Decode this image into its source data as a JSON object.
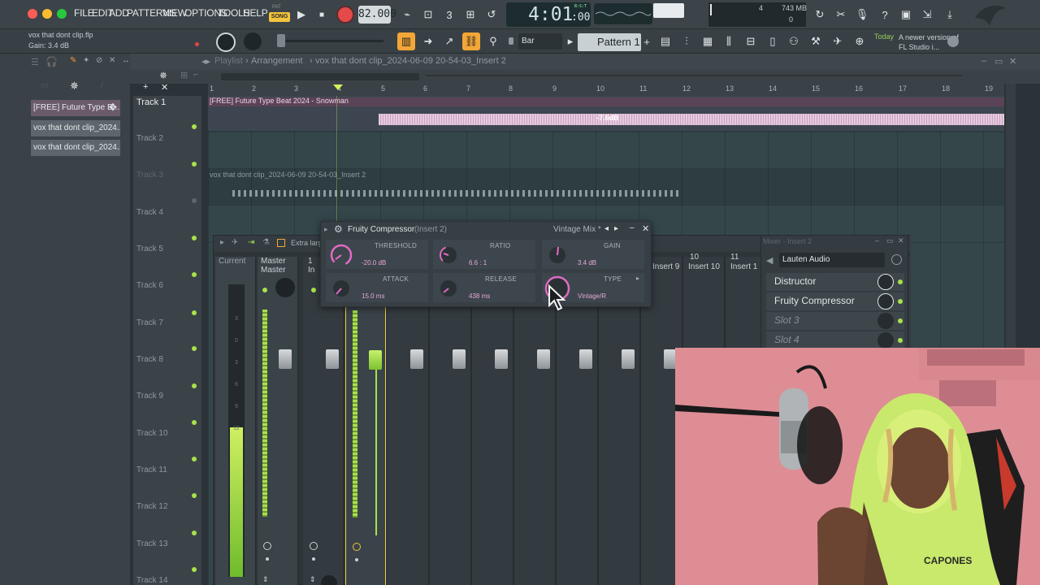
{
  "menu": [
    "FILE",
    "EDIT",
    "ADD",
    "PATTERNS",
    "VIEW",
    "OPTIONS",
    "TOOLS",
    "HELP"
  ],
  "transport": {
    "mode_label": "SONG",
    "mode_sub": "PAT",
    "tempo": "82.000",
    "time": "4:01",
    "time_small": ":00",
    "time_label": "B:S:T"
  },
  "stats": {
    "memory": "743 MB",
    "cpu_count": "4",
    "voices": "0"
  },
  "hint": {
    "file": "vox that dont clip.flp",
    "gain": "Gain: 3.4 dB"
  },
  "pattern": {
    "snap": "Bar",
    "name": "Pattern 1"
  },
  "news": {
    "label": "Today",
    "text": "A newer version of FL Studio i..."
  },
  "playlist": {
    "title": "Playlist",
    "sep": "›",
    "breadcrumb": "Arrangement",
    "file": "vox that dont clip_2024-06-09 20-54-03_Insert 2",
    "ruler": [
      "1",
      "2",
      "3",
      "4",
      "5",
      "6",
      "7",
      "8",
      "9",
      "10",
      "11",
      "12",
      "13",
      "14",
      "15",
      "16",
      "17",
      "18",
      "19"
    ],
    "tracks": [
      "Track 1",
      "Track 2",
      "Track 3",
      "Track 4",
      "Track 5",
      "Track 6",
      "Track 7",
      "Track 8",
      "Track 9",
      "Track 10",
      "Track 11",
      "Track 12",
      "Track 13",
      "Track 14"
    ],
    "clip1": {
      "title": "[FREE] Future Type Beat 2024 - Snowman",
      "gain": "-7.6dB"
    },
    "clip2": {
      "title": "vox that dont clip_2024-06-09 20-54-03_Insert 2"
    }
  },
  "browser": {
    "items": [
      "[FREE] Future Type B...",
      "vox that dont clip_2024...",
      "vox that dont clip_2024..."
    ]
  },
  "compressor": {
    "title": "Fruity Compressor",
    "insert": "(Insert 2)",
    "preset": "Vintage Mix *",
    "params": [
      {
        "label": "THRESHOLD",
        "value": "-20.0 dB"
      },
      {
        "label": "RATIO",
        "value": "6.6 : 1"
      },
      {
        "label": "GAIN",
        "value": "3.4 dB"
      },
      {
        "label": "ATTACK",
        "value": "15.0 ms"
      },
      {
        "label": "RELEASE",
        "value": "438 ms"
      },
      {
        "label": "TYPE",
        "value": "Vintage/R"
      }
    ],
    "accent": "#e06bc4"
  },
  "mixer": {
    "title": "Extra large",
    "current": "Current",
    "master": "Master",
    "insert_prefix": "In",
    "insert_num": "1",
    "strips": [
      "Insert 9",
      "Insert 10",
      "Insert 1"
    ],
    "strip_nums": [
      "",
      "10",
      "11"
    ],
    "scale": [
      "3",
      "0",
      "3",
      "6",
      "9",
      "12"
    ],
    "meter_color": "#a8e24a"
  },
  "inserts_panel": {
    "title": "Mixer - Insert 2",
    "device": "Lauten Audio",
    "slots": [
      "Distructor",
      "Fruity Compressor",
      "Slot 3",
      "Slot 4"
    ]
  }
}
